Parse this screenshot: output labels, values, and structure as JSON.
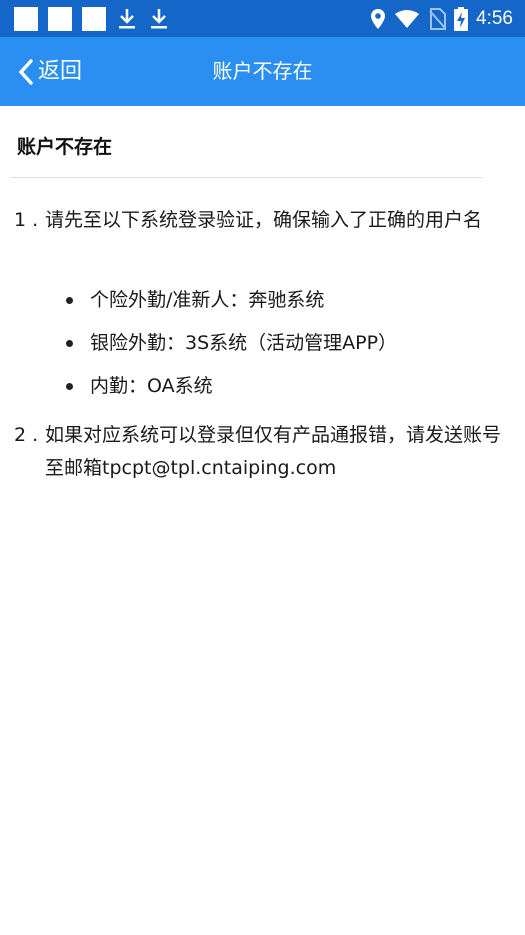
{
  "status_bar": {
    "time": "4:56",
    "icons": [
      "notification-square-icon",
      "notification-square-icon",
      "notification-square-icon",
      "download-icon",
      "download-icon",
      "location-icon",
      "wifi-icon",
      "no-sim-icon",
      "battery-charging-icon"
    ]
  },
  "app_bar": {
    "back_label": "返回",
    "title": "账户不存在",
    "color": "#2a8ff0"
  },
  "content": {
    "heading": "账户不存在",
    "items": [
      {
        "number": "1 .",
        "text": "请先至以下系统登录验证，确保输入了正确的用户名",
        "bullets": [
          "个险外勤/准新人：奔驰系统",
          "银险外勤：3S系统（活动管理APP）",
          "内勤：OA系统"
        ]
      },
      {
        "number": "2 .",
        "text": "如果对应系统可以登录但仅有产品通报错，请发送账号至邮箱tpcpt@tpl.cntaiping.com"
      }
    ]
  }
}
